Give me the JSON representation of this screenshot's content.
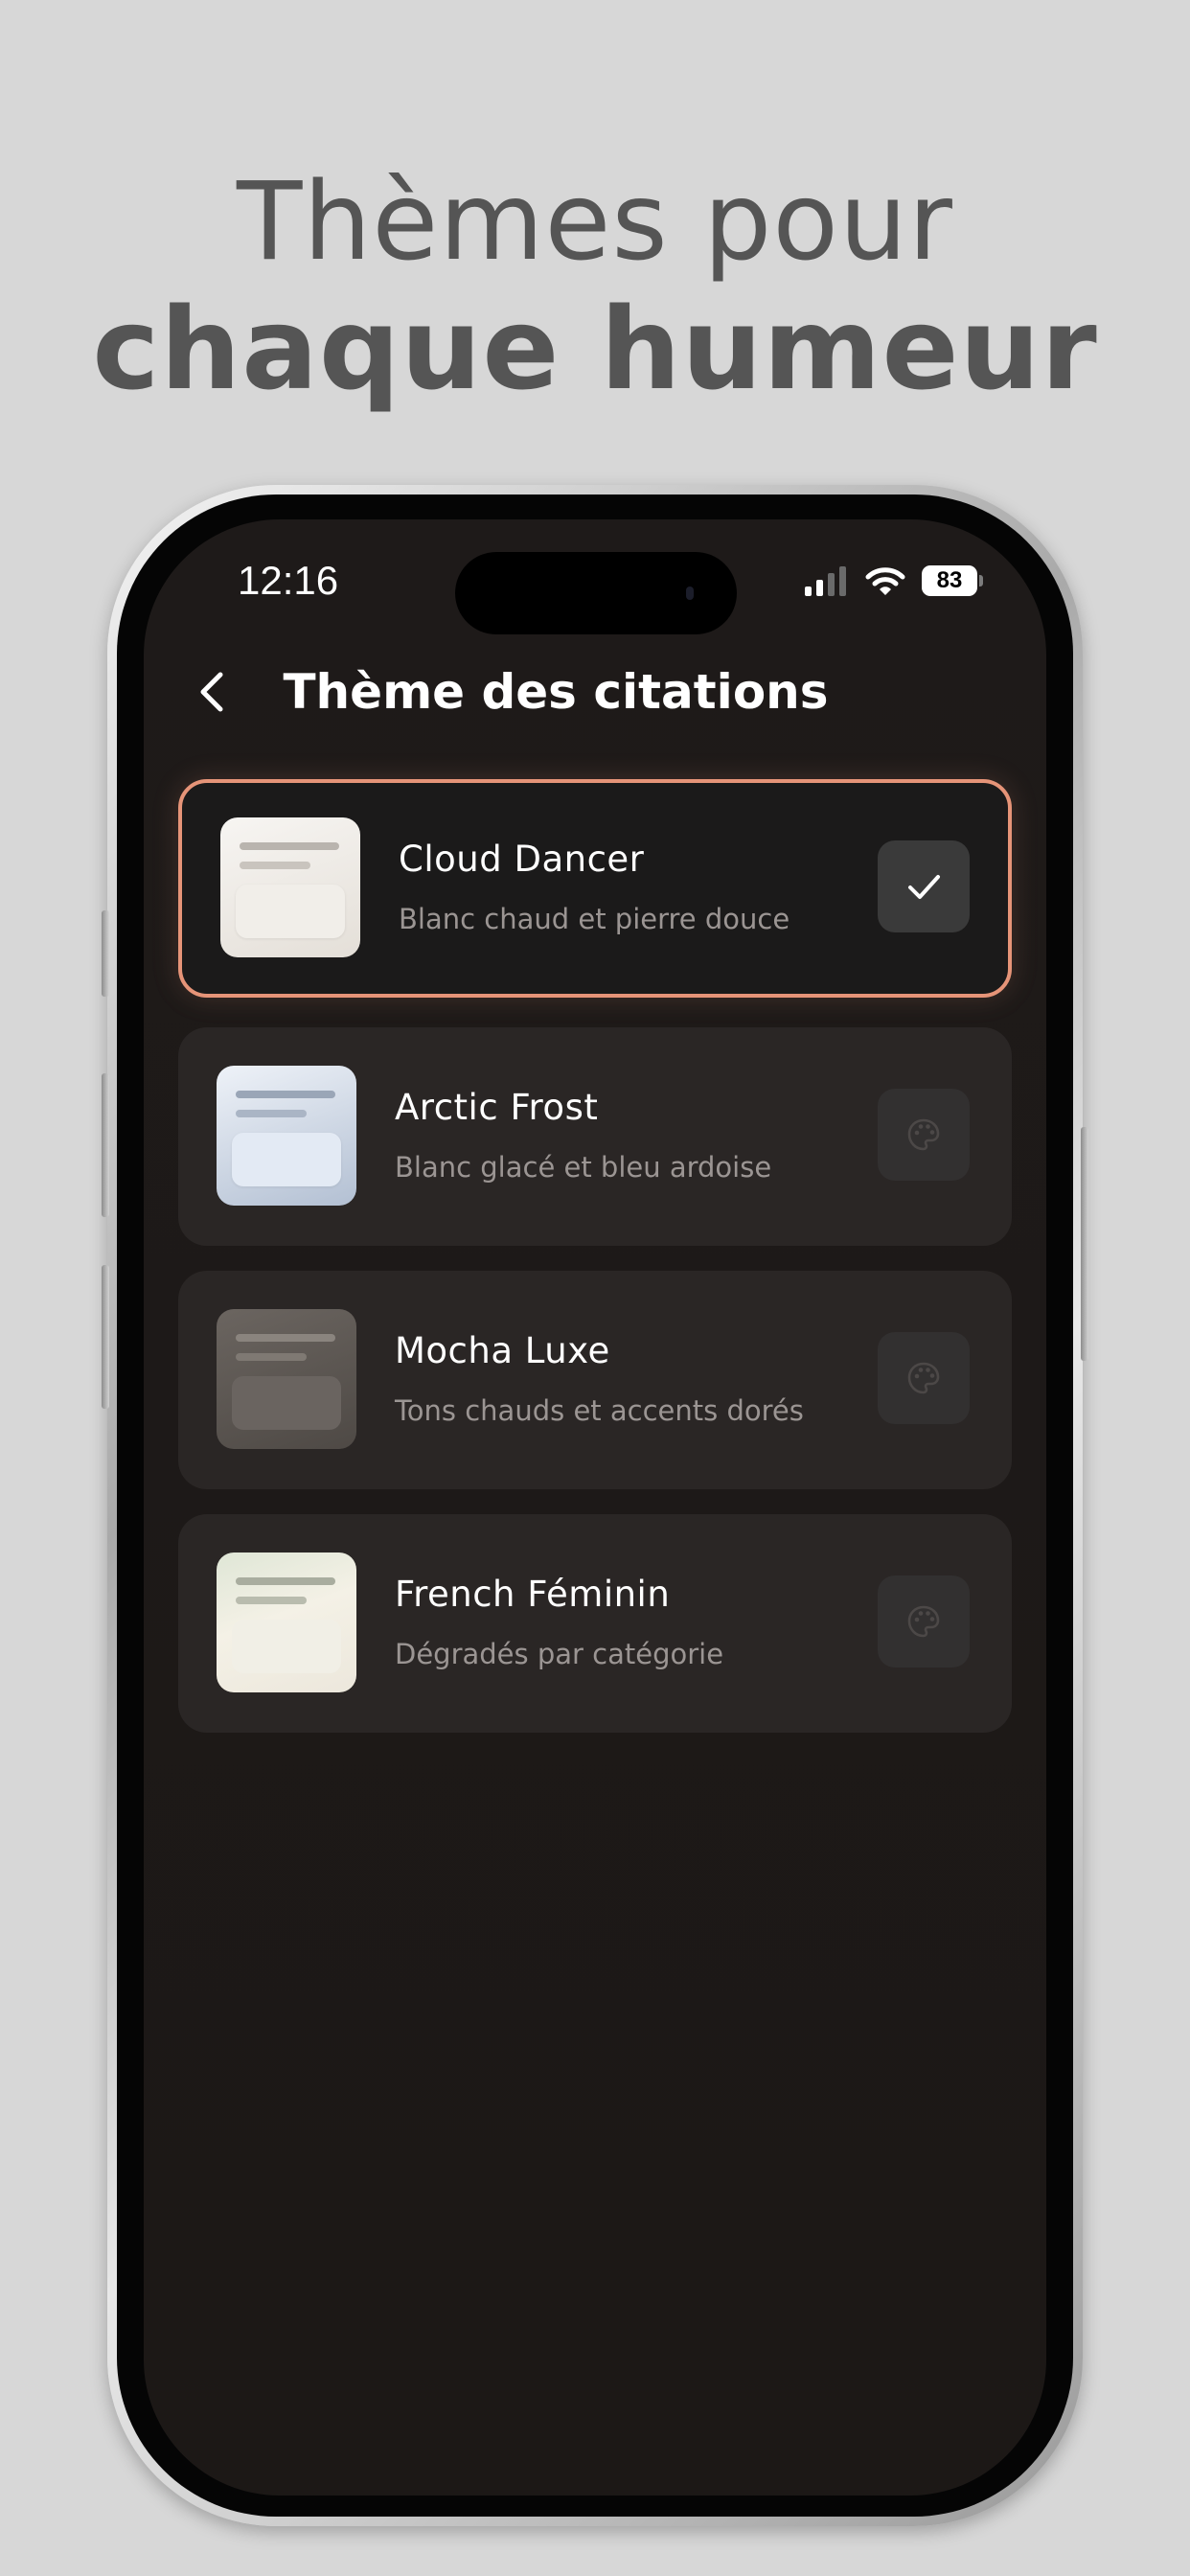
{
  "promo": {
    "line1": "Thèmes pour",
    "line2": "chaque humeur"
  },
  "status_bar": {
    "time": "12:16",
    "battery": "83"
  },
  "header": {
    "title": "Thème des citations",
    "back_icon": "chevron-left-icon"
  },
  "themes": [
    {
      "name": "Cloud Dancer",
      "description": "Blanc chaud et pierre douce",
      "selected": true,
      "action_icon": "checkmark-icon"
    },
    {
      "name": "Arctic Frost",
      "description": "Blanc glacé et bleu ardoise",
      "selected": false,
      "action_icon": "palette-icon"
    },
    {
      "name": "Mocha Luxe",
      "description": "Tons chauds et accents dorés",
      "selected": false,
      "action_icon": "palette-icon"
    },
    {
      "name": "French Féminin",
      "description": "Dégradés par catégorie",
      "selected": false,
      "action_icon": "palette-icon"
    }
  ],
  "colors": {
    "background": "#d7d7d7",
    "promo_text": "#555555",
    "screen": "#1e1a19",
    "card": "#2a2625",
    "selected_border": "#e69478",
    "subtitle": "#9b9593"
  }
}
